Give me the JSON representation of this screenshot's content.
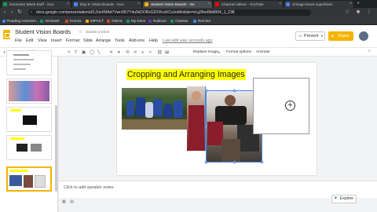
{
  "browser": {
    "tabs": [
      {
        "label": "Geometry Week Stuff - Goo",
        "active": false,
        "color": "#0f9d58"
      },
      {
        "label": "Day 6: Vision Boards - Goo",
        "active": false,
        "color": "#4285f4"
      },
      {
        "label": "Student Vision Boards - Go",
        "active": true,
        "color": "#f4b400"
      },
      {
        "label": "Channel videos - YouTube",
        "active": false,
        "color": "#ff0000"
      },
      {
        "label": "chicago bears superbowl",
        "active": false,
        "color": "#4285f4"
      }
    ],
    "url": "docs.google.com/presentation/d/1JUeIRfAd7Vwn9D7Ydu5kDORzGDXKvvKCc/edit#slide=id.g3fee6fd4004_1_238",
    "bookmarks": [
      {
        "label": "Reading Assessm...",
        "color": "#4285f4"
      },
      {
        "label": "Aimsweb",
        "color": "#0f9d58"
      },
      {
        "label": "Kronos",
        "color": "#db4437"
      },
      {
        "label": "IMPACT",
        "color": "#f4b400"
      },
      {
        "label": "GMAIL",
        "color": "#db4437"
      },
      {
        "label": "My Drive",
        "color": "#0f9d58"
      },
      {
        "label": "Rubicon",
        "color": "#673ab7"
      },
      {
        "label": "Classes",
        "color": "#0f9d58"
      },
      {
        "label": "Remind",
        "color": "#4285f4"
      }
    ]
  },
  "app": {
    "title": "Student Vision Boards",
    "saved_status": "Saved to Drive",
    "last_edit": "Last edit was seconds ago",
    "menu": [
      "File",
      "Edit",
      "View",
      "Insert",
      "Format",
      "Slide",
      "Arrange",
      "Tools",
      "Add-ons",
      "Help"
    ],
    "present_label": "Present",
    "share_label": "Share",
    "accent": "#f4b400"
  },
  "toolbar": {
    "replace_image": "Replace image",
    "format_options": "Format options",
    "animate": "Animate"
  },
  "slide": {
    "title": "Cropping and Arranging Images"
  },
  "notes": {
    "placeholder": "Click to add speaker notes"
  },
  "explore": {
    "label": "Explore"
  }
}
